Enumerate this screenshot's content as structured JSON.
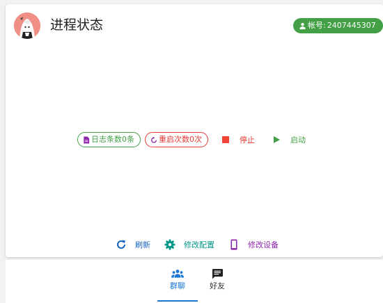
{
  "header": {
    "title": "进程状态",
    "account_label": "帐号:",
    "account_number": "2407445307"
  },
  "status": {
    "log_chip": "日志条数0条",
    "restart_chip": "重启次数0次",
    "stop_label": "停止",
    "start_label": "启动"
  },
  "actions": {
    "refresh_label": "刷新",
    "config_label": "修改配置",
    "device_label": "修改设备"
  },
  "tabs": [
    {
      "label": "群聊",
      "icon": "group-icon",
      "active": true
    },
    {
      "label": "好友",
      "icon": "chat-icon",
      "active": false
    }
  ],
  "colors": {
    "green": "#43a047",
    "red": "#e53935",
    "blue": "#1976d2",
    "teal": "#009688",
    "purple": "#8e24aa"
  }
}
